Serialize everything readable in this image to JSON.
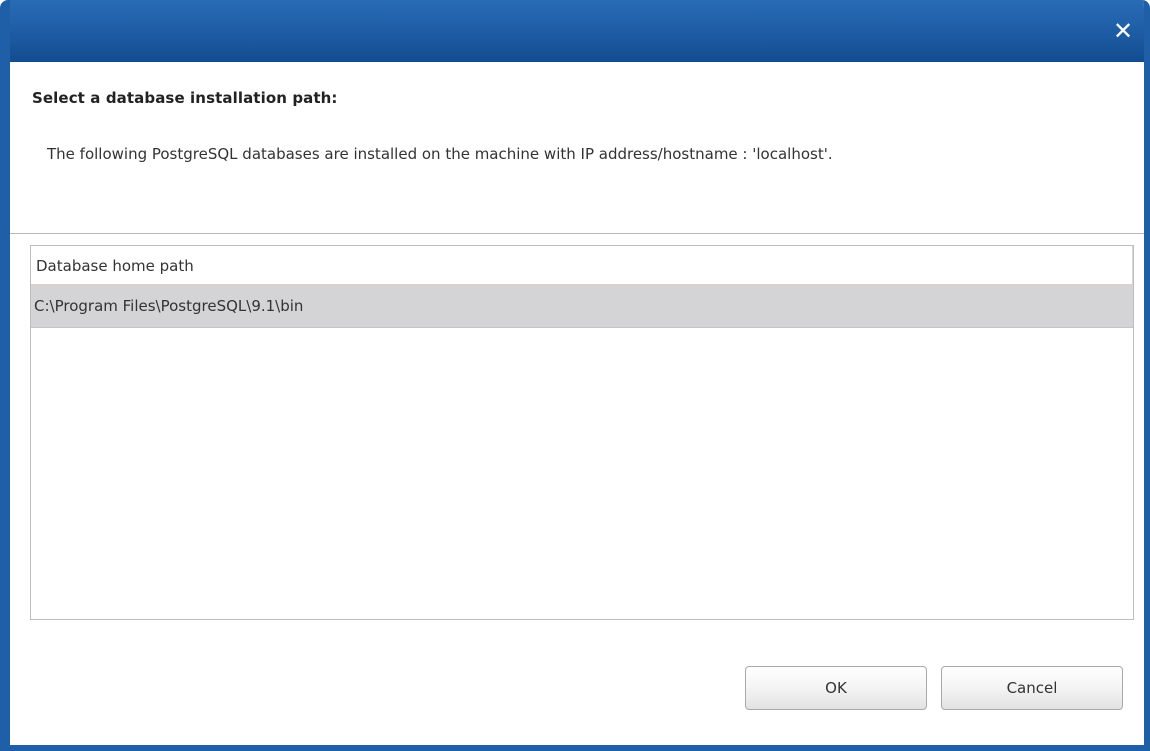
{
  "window": {
    "close_label": "✕"
  },
  "heading": "Select a database installation path:",
  "description": "The following PostgreSQL databases are installed on the machine with IP address/hostname : 'localhost'.",
  "table": {
    "columns": [
      "Database home path"
    ],
    "rows": [
      [
        "C:\\Program Files\\PostgreSQL\\9.1\\bin"
      ]
    ],
    "selected_row": 0
  },
  "buttons": {
    "ok": "OK",
    "cancel": "Cancel"
  },
  "colors": {
    "titlebar": "#1f5fa8",
    "selected_row": "#d4d3d6"
  }
}
